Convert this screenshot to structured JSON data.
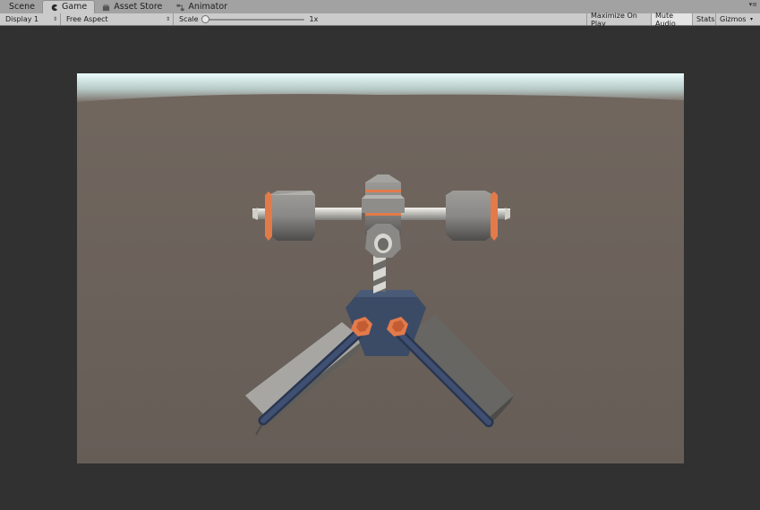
{
  "tabs": [
    {
      "label": "Scene",
      "icon": "scene-icon"
    },
    {
      "label": "Game",
      "icon": "pacman-icon",
      "active": true
    },
    {
      "label": "Asset Store",
      "icon": "store-icon"
    },
    {
      "label": "Animator",
      "icon": "animator-icon"
    }
  ],
  "toolbar": {
    "display": "Display 1",
    "aspect": "Free Aspect",
    "scale_label": "Scale",
    "scale_value": "1x",
    "scale_level": 0,
    "maximize": "Maximize On Play",
    "mute": "Mute Audio",
    "stats": "Stats",
    "gizmos": "Gizmos"
  },
  "colors": {
    "editor_background": "#313131",
    "ground": "#6a615a",
    "sky_light": "#e9fbfb",
    "metal": "#8e8e8c",
    "navy": "#3b4b66",
    "accent_orange": "#e37a4a"
  }
}
